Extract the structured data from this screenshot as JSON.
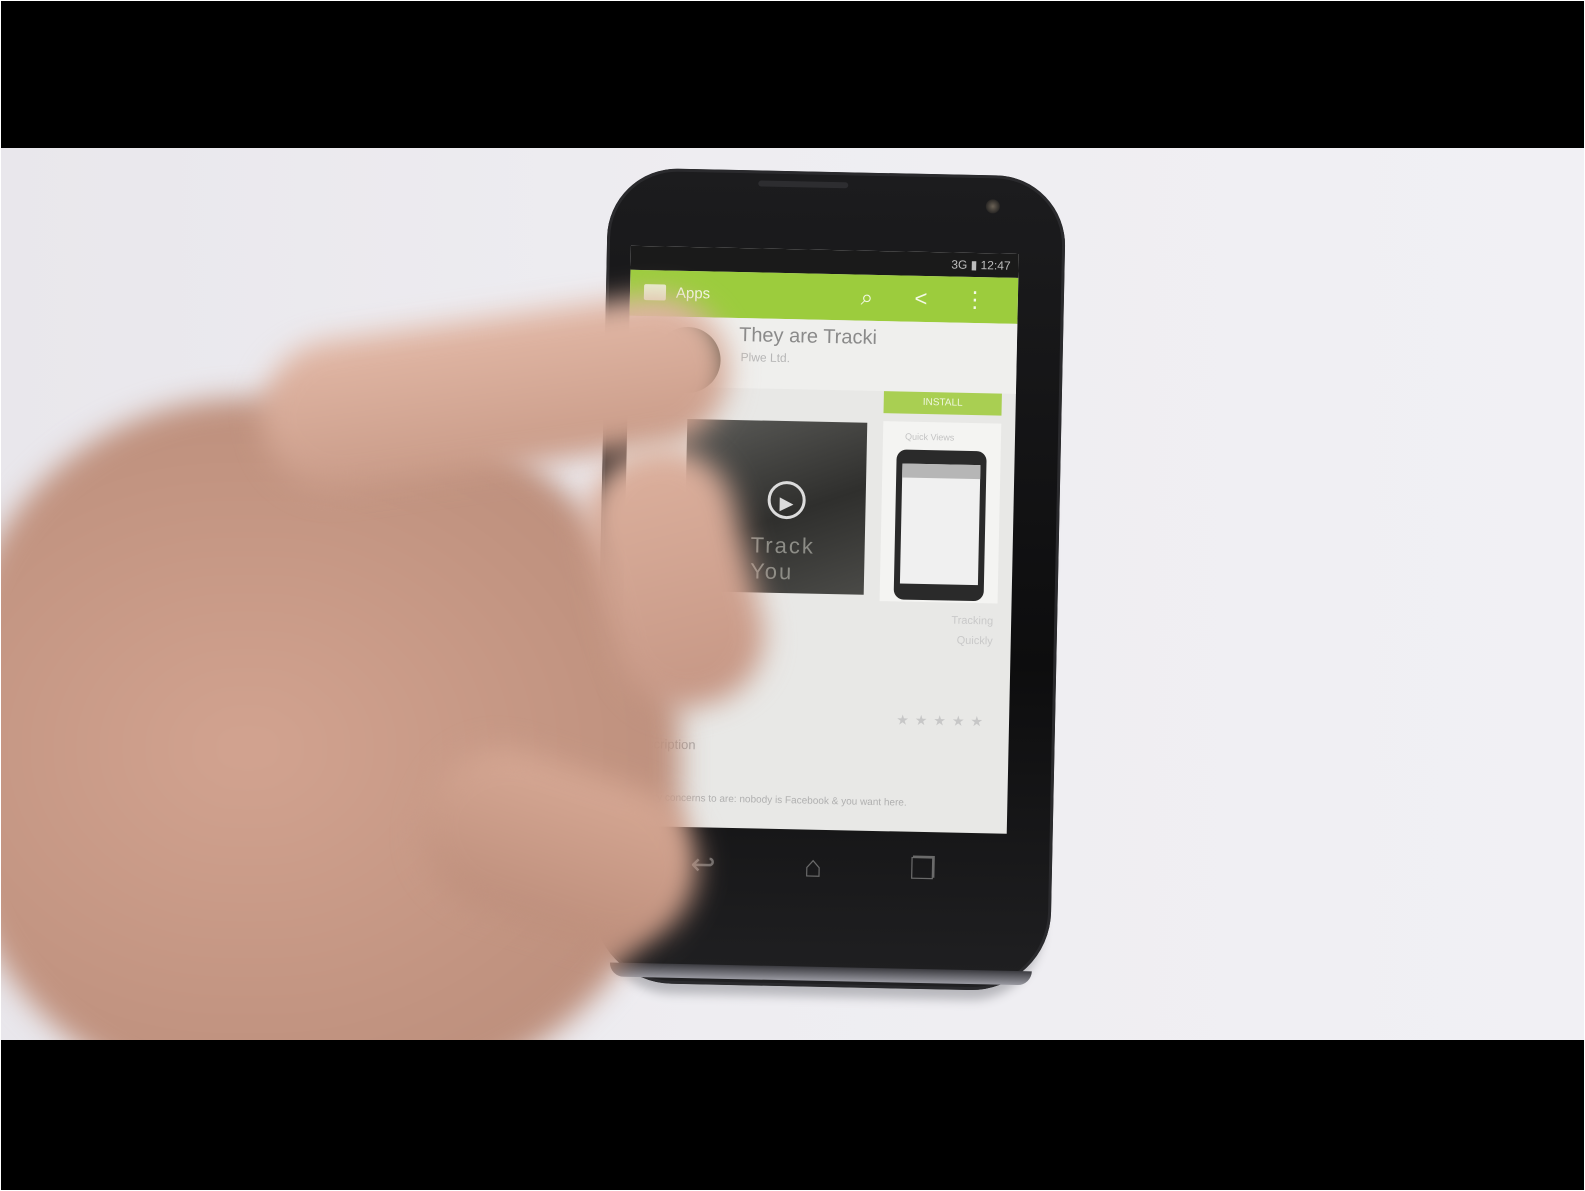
{
  "statusbar": {
    "status_text": "3G ▮ 12:47"
  },
  "actionbar": {
    "title": "Apps",
    "search_icon": "search-icon",
    "share_icon": "share-icon",
    "overflow_icon": "overflow-icon"
  },
  "app": {
    "name": "They are Tracki",
    "developer": "Plwe Ltd.",
    "install_label": "INSTALL",
    "video_caption": "Track You",
    "screenshot_label": "Quick Views",
    "meta_line1": "Tracking",
    "meta_line2": "Quickly",
    "rating_stars": "★★★★★",
    "description_title": "Description",
    "description_text": "Privacy concerns to are: nobody is Facebook & you want here."
  },
  "navbar": {
    "back_icon": "back-icon",
    "home_icon": "home-icon",
    "recents_icon": "recents-icon"
  },
  "colors": {
    "accent": "#9ccc3d",
    "letterbox": "#000000",
    "background": "#eeedf1"
  }
}
